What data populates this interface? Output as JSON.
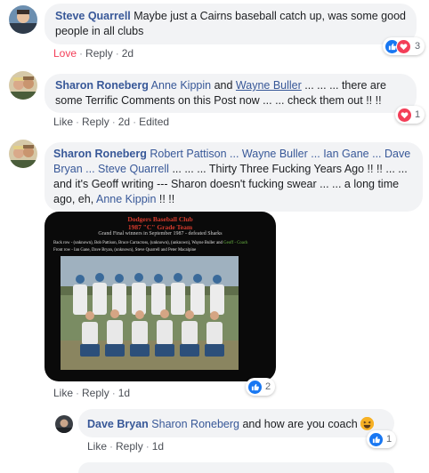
{
  "comment1": {
    "author": "Steve Quarrell",
    "text": "Maybe just a Cairns baseball catch up, was some good people in all clubs",
    "reaction_label": "Love",
    "reply_label": "Reply",
    "time": "2d",
    "reaction_count": "3"
  },
  "comment2": {
    "author": "Sharon Roneberg",
    "mention1": "Anne Kippin",
    "and_word": "and",
    "mention2": "Wayne Buller",
    "text": "... ... ... there are some Terrific Comments on this Post now ... ... check them out !! !!",
    "like_label": "Like",
    "reply_label": "Reply",
    "time": "2d",
    "edited_label": "Edited",
    "reaction_count": "1"
  },
  "comment3": {
    "author": "Sharon Roneberg",
    "mention_robert": "Robert Pattison",
    "sep1": "...",
    "mention_wayne": "Wayne Buller",
    "sep2": "...",
    "mention_ian": "Ian Gane",
    "sep3": "...",
    "mention_dave": "Dave Bryan",
    "sep4": "...",
    "mention_steve": "Steve Quarrell",
    "text_mid": "... ... ... Thirty Three Fucking Years Ago !! !! ... ... and it's Geoff writing --- Sharon doesn't fucking swear ... ... a long time ago, eh,",
    "mention_anne": "Anne Kippin",
    "text_end": "!! !!",
    "like_label": "Like",
    "reply_label": "Reply",
    "time": "1d",
    "reaction_count": "2",
    "photo": {
      "title_line1": "Dodgers Baseball Club",
      "title_line2": "1987 \"C\" Grade Team",
      "subtitle": "Grand Final winners in September 1987 - defeated Sharks",
      "back_row": "Back row - (unknown), Bob Pattison, Bruce Carracross, (unknown), (unknown), Wayne Buller and",
      "back_row_coach": "Geoff - Coach",
      "front_row": "Front row - Ian Gane, Dave Bryan, (unknown), Steve Quarrell and Peter Macalpine"
    }
  },
  "reply1": {
    "author": "Dave Bryan",
    "mention": "Sharon Roneberg",
    "text": "and how are you coach",
    "like_label": "Like",
    "reply_label": "Reply",
    "time": "1d",
    "reaction_count": "1"
  },
  "colors": {
    "link": "#385898",
    "bubble": "#f2f3f5",
    "love": "#f33e58",
    "like": "#1877f2",
    "meta": "#606770"
  },
  "icons": [
    "like-reaction-icon",
    "love-reaction-icon",
    "haha-emoji-icon"
  ]
}
